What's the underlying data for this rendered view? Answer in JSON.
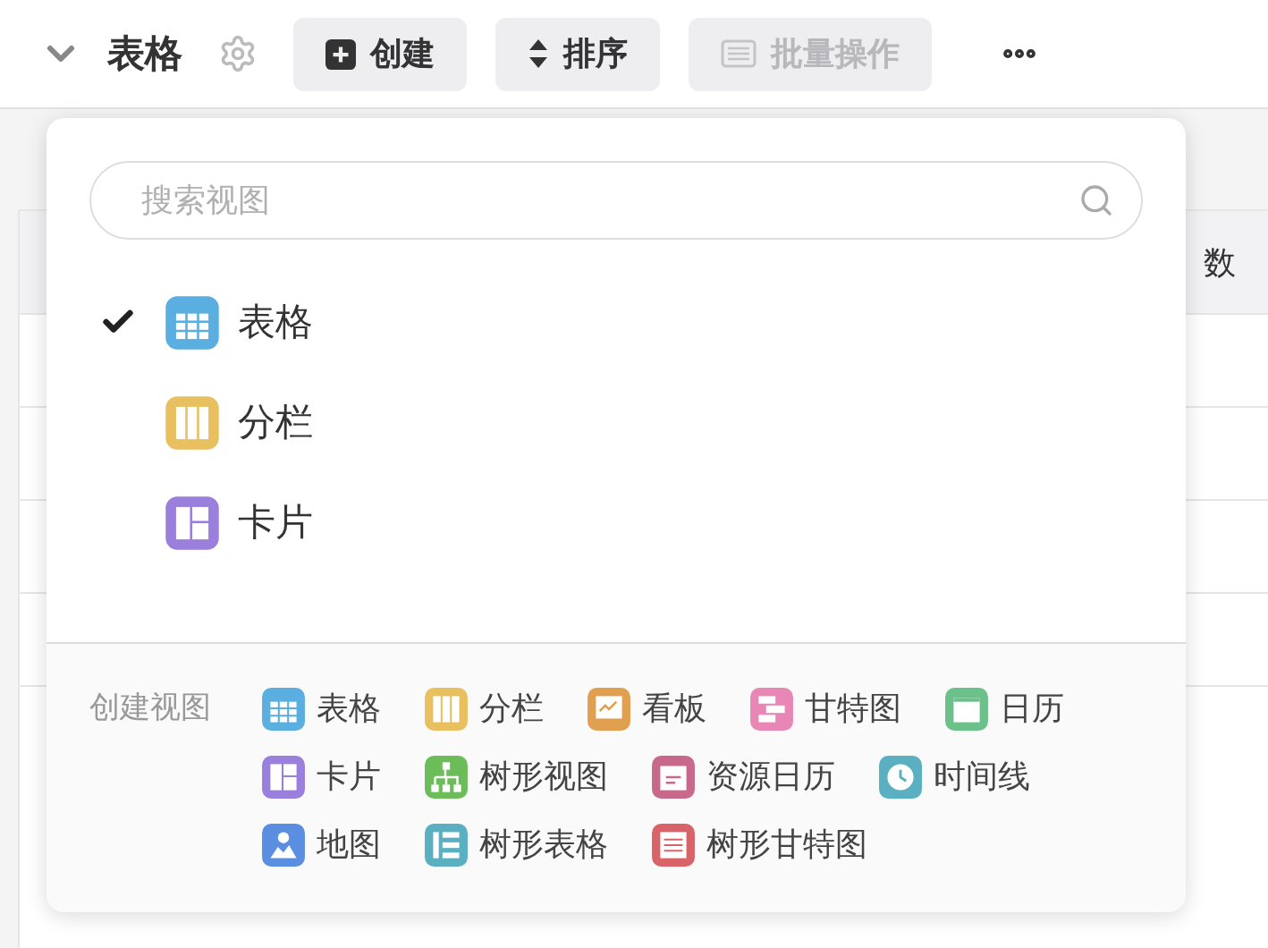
{
  "header": {
    "title": "表格"
  },
  "toolbar": [
    {
      "label": "创建",
      "kind": "plus",
      "disabled": false
    },
    {
      "label": "排序",
      "kind": "sort",
      "disabled": false
    },
    {
      "label": "批量操作",
      "kind": "batch",
      "disabled": true
    }
  ],
  "table": {
    "column_header": "数"
  },
  "view_menu": {
    "search": {
      "placeholder": "搜索视图"
    },
    "views": [
      {
        "label": "表格",
        "kind": "table",
        "color": "#5aaee0",
        "selected": true
      },
      {
        "label": "分栏",
        "kind": "columns",
        "color": "#e8c060",
        "selected": false
      },
      {
        "label": "卡片",
        "kind": "card",
        "color": "#9b7fdc",
        "selected": false
      }
    ],
    "create": {
      "label": "创建视图",
      "rows": [
        [
          {
            "label": "表格",
            "kind": "table",
            "color": "#5aaee0"
          },
          {
            "label": "分栏",
            "kind": "columns",
            "color": "#e8c060"
          },
          {
            "label": "看板",
            "kind": "kanban",
            "color": "#e0a050"
          },
          {
            "label": "甘特图",
            "kind": "gantt",
            "color": "#e887b5"
          },
          {
            "label": "日历",
            "kind": "calendar",
            "color": "#6cc08a"
          }
        ],
        [
          {
            "label": "卡片",
            "kind": "card",
            "color": "#9b7fdc"
          },
          {
            "label": "树形视图",
            "kind": "tree",
            "color": "#6cbc5a"
          },
          {
            "label": "资源日历",
            "kind": "resource-calendar",
            "color": "#c8688a"
          },
          {
            "label": "时间线",
            "kind": "timeline",
            "color": "#5ab0c0"
          }
        ],
        [
          {
            "label": "地图",
            "kind": "map",
            "color": "#5a8ee0"
          },
          {
            "label": "树形表格",
            "kind": "tree-table",
            "color": "#5ab0c0"
          },
          {
            "label": "树形甘特图",
            "kind": "tree-gantt",
            "color": "#d8646a"
          }
        ]
      ]
    }
  }
}
